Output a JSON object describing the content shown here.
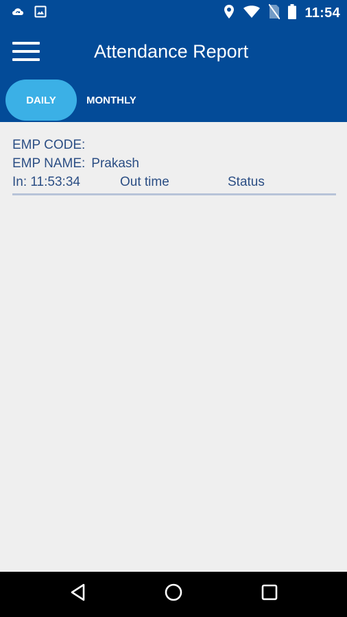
{
  "status_bar": {
    "time": "11:54"
  },
  "header": {
    "title": "Attendance Report"
  },
  "tabs": [
    {
      "label": "DAILY",
      "active": true
    },
    {
      "label": "MONTHLY",
      "active": false
    }
  ],
  "record": {
    "emp_code_label": "EMP CODE:",
    "emp_name_label": "EMP NAME:",
    "emp_name_value": "Prakash",
    "in_label": "In: 11:53:34",
    "out_label": "Out time",
    "status_label": "Status"
  },
  "colors": {
    "primary": "#034b98",
    "tab_active": "#3bb0e6",
    "text": "#2b4e84",
    "background": "#efefef"
  },
  "icons": {
    "status_left": [
      "sync-cloud-icon",
      "image-icon"
    ],
    "status_right": [
      "location-icon",
      "wifi-icon",
      "no-sim-icon",
      "battery-icon"
    ],
    "navigation": [
      "back-icon",
      "home-icon",
      "recent-apps-icon"
    ]
  }
}
